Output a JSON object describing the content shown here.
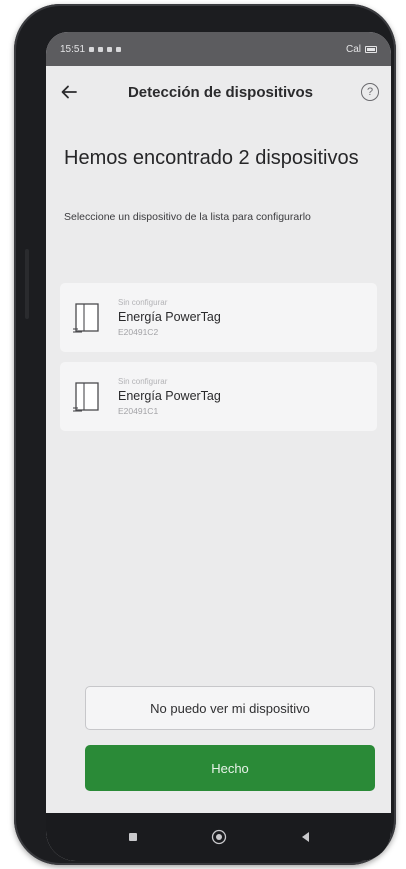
{
  "status_bar": {
    "time": "15:51",
    "right_text": "Cal"
  },
  "top_bar": {
    "back_icon": "arrow-left-icon",
    "title": "Detección de dispositivos",
    "help_icon": "?"
  },
  "main": {
    "heading": "Hemos encontrado 2 dispositivos",
    "subheading": "Seleccione un dispositivo de la lista para configurarlo"
  },
  "devices": [
    {
      "status": "Sin configurar",
      "name": "Energía PowerTag",
      "id": "E20491C2",
      "icon": "powertag-device-icon"
    },
    {
      "status": "Sin configurar",
      "name": "Energía PowerTag",
      "id": "E20491C1",
      "icon": "powertag-device-icon"
    }
  ],
  "buttons": {
    "cant_see_label": "No puedo ver mi dispositivo",
    "done_label": "Hecho"
  },
  "colors": {
    "primary": "#2a8a37",
    "background": "#ebebec",
    "card": "#f5f5f6"
  }
}
